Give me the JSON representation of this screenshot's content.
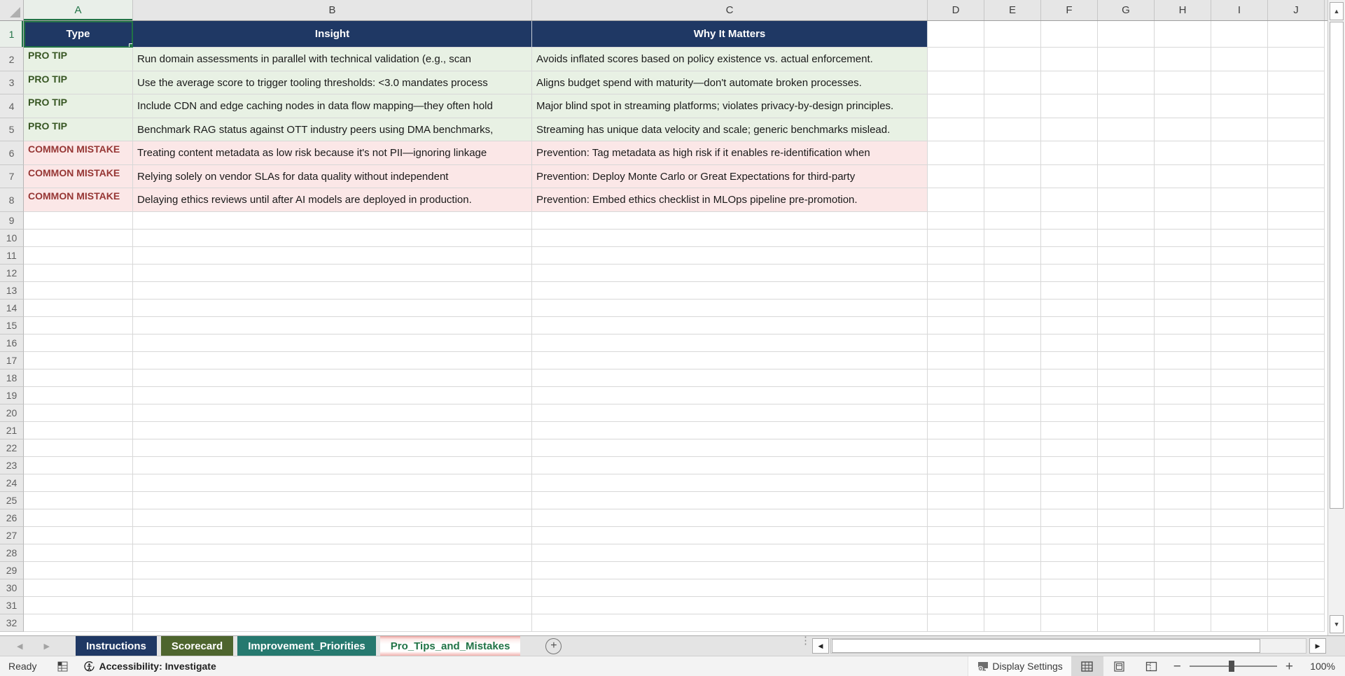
{
  "columns": [
    "A",
    "B",
    "C",
    "D",
    "E",
    "F",
    "G",
    "H",
    "I",
    "J"
  ],
  "row_count": 32,
  "selection": {
    "active_cell": "A1"
  },
  "table": {
    "headers": [
      "Type",
      "Insight",
      "Why It Matters"
    ],
    "rows": [
      {
        "kind": "tip",
        "type": "PRO TIP",
        "insight": "Run domain assessments in parallel with technical validation (e.g., scan",
        "why": "Avoids inflated scores based on policy existence vs. actual enforcement."
      },
      {
        "kind": "tip",
        "type": "PRO TIP",
        "insight": "Use the average score to trigger tooling thresholds: <3.0 mandates process",
        "why": "Aligns budget spend with maturity—don't automate broken processes."
      },
      {
        "kind": "tip",
        "type": "PRO TIP",
        "insight": "Include CDN and edge caching nodes in data flow mapping—they often hold",
        "why": "Major blind spot in streaming platforms; violates privacy-by-design principles."
      },
      {
        "kind": "tip",
        "type": "PRO TIP",
        "insight": "Benchmark RAG status against OTT industry peers using DMA benchmarks,",
        "why": "Streaming has unique data velocity and scale; generic benchmarks mislead."
      },
      {
        "kind": "mistake",
        "type": "COMMON MISTAKE",
        "insight": "Treating content metadata as low risk because it's not PII—ignoring linkage",
        "why": "Prevention: Tag metadata as high risk if it enables re-identification when"
      },
      {
        "kind": "mistake",
        "type": "COMMON MISTAKE",
        "insight": "Relying solely on vendor SLAs for data quality without independent",
        "why": "Prevention: Deploy Monte Carlo or Great Expectations for third-party"
      },
      {
        "kind": "mistake",
        "type": "COMMON MISTAKE",
        "insight": "Delaying ethics reviews until after AI models are deployed in production.",
        "why": "Prevention: Embed ethics checklist in MLOps pipeline pre-promotion."
      }
    ]
  },
  "sheet_tabs": [
    {
      "label": "Instructions",
      "color": "#1F3864",
      "text_color": "#FFFFFF",
      "active": false
    },
    {
      "label": "Scorecard",
      "color": "#4E652E",
      "text_color": "#FFFFFF",
      "active": false
    },
    {
      "label": "Improvement_Priorities",
      "color": "#26796F",
      "text_color": "#FFFFFF",
      "active": false
    },
    {
      "label": "Pro_Tips_and_Mistakes",
      "color": "#FFFFFF",
      "text_color": "#217346",
      "active": true
    }
  ],
  "tab_bar": {
    "new_sheet_glyph": "+",
    "prev_glyph": "◀",
    "next_glyph": "▶"
  },
  "scrollbar": {
    "up_glyph": "▲",
    "down_glyph": "▼",
    "left_glyph": "◀",
    "right_glyph": "▶",
    "grip_glyph": "⋮"
  },
  "status_bar": {
    "ready": "Ready",
    "accessibility": "Accessibility: Investigate",
    "display_settings": "Display Settings",
    "zoom_minus": "−",
    "zoom_plus": "+",
    "zoom_label": "100%"
  },
  "colors": {
    "table_header_fill": "#1F3864",
    "tip_fill": "#E8F1E4",
    "tip_text": "#375623",
    "mistake_fill": "#FBE7E7",
    "mistake_text": "#963634",
    "selection_accent": "#217346",
    "active_tab_accent": "#F2A9A6"
  }
}
